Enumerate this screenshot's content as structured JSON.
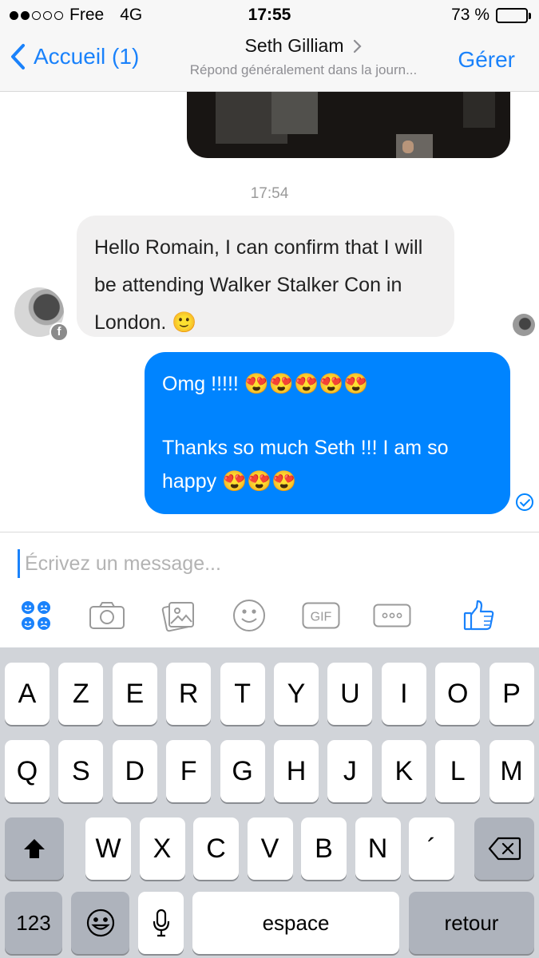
{
  "status_bar": {
    "carrier": "Free",
    "network": "4G",
    "time": "17:55",
    "battery": "73 %",
    "battery_level": 0.73
  },
  "nav": {
    "back_label": "Accueil (1)",
    "contact_name": "Seth Gilliam",
    "contact_subtitle": "Répond généralement dans la journ...",
    "manage_label": "Gérer"
  },
  "conversation": {
    "timestamp": "17:54",
    "incoming": {
      "text": "Hello Romain, I can confirm that I will be attending Walker Stalker Con in London. 🙂"
    },
    "outgoing": {
      "line1": "Omg !!!!! 😍😍😍😍😍",
      "line2": "Thanks so much Seth !!! I am so happy 😍😍😍"
    },
    "badge_letter": "f"
  },
  "composer": {
    "placeholder": "Écrivez un message..."
  },
  "toolbar_icons": [
    "stickers-icon",
    "camera-icon",
    "gallery-icon",
    "emoji-icon",
    "gif-icon",
    "more-icon",
    "like-icon"
  ],
  "toolbar": {
    "gif_label": "GIF"
  },
  "colors": {
    "accent": "#1a82fb",
    "outgoing_bubble": "#0084ff",
    "incoming_bubble": "#f1f0f0",
    "keyboard_bg": "#d1d4d9"
  },
  "keyboard": {
    "row1": [
      "A",
      "Z",
      "E",
      "R",
      "T",
      "Y",
      "U",
      "I",
      "O",
      "P"
    ],
    "row2": [
      "Q",
      "S",
      "D",
      "F",
      "G",
      "H",
      "J",
      "K",
      "L",
      "M"
    ],
    "row3": [
      "W",
      "X",
      "C",
      "V",
      "B",
      "N",
      "´"
    ],
    "numbers_label": "123",
    "space_label": "espace",
    "return_label": "retour"
  }
}
